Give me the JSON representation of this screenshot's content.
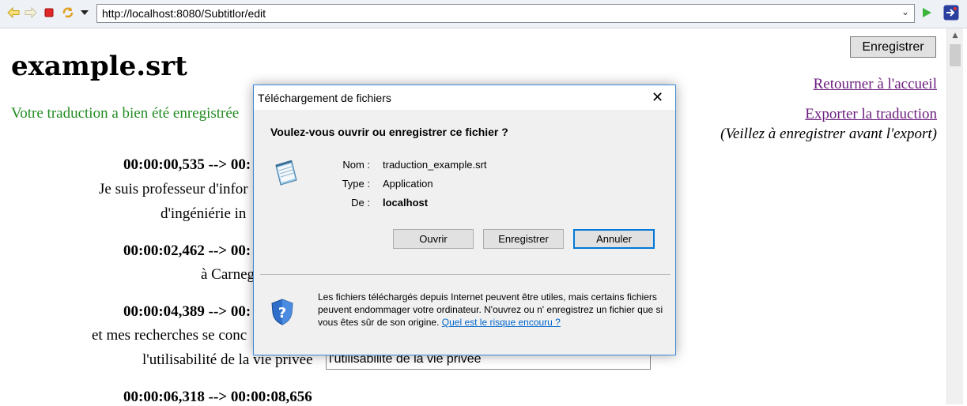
{
  "browser": {
    "url": "http://localhost:8080/Subtitlor/edit",
    "toolbar_icons": [
      "back-arrow-icon",
      "forward-arrow-icon",
      "stop-icon",
      "refresh-icon",
      "dropdown-icon",
      "go-icon",
      "browser-app-icon"
    ]
  },
  "page": {
    "title": "example.srt",
    "save_label": "Enregistrer",
    "home_link": "Retourner à l'accueil",
    "export_link": "Exporter la traduction",
    "export_note": "(Veillez à enregistrer avant l'export)",
    "success_message": "Votre traduction a bien été enregistrée"
  },
  "subtitles": [
    {
      "timestamp": "00:00:00,535 --> 00:",
      "line1": "Je suis professeur d'infor",
      "line2": "d'ingéniérie in"
    },
    {
      "timestamp": "00:00:02,462 --> 00:",
      "line1": "à Carneg"
    },
    {
      "timestamp": "00:00:04,389 --> 00:",
      "line1": "et mes recherches se conc",
      "line2": "l'utilisabilité de la vie privée",
      "input_value": "l'utilisabilité de la vie privée"
    },
    {
      "timestamp": "00:00:06,318 --> 00:00:08,656"
    }
  ],
  "dialog": {
    "title": "Téléchargement de fichiers",
    "question": "Voulez-vous ouvrir ou enregistrer ce fichier ?",
    "name_label": "Nom :",
    "name_value": "traduction_example.srt",
    "type_label": "Type :",
    "type_value": "Application",
    "from_label": "De :",
    "from_value": "localhost",
    "buttons": {
      "open": "Ouvrir",
      "save": "Enregistrer",
      "cancel": "Annuler"
    },
    "warning_text": "Les fichiers téléchargés depuis Internet peuvent être utiles, mais certains fichiers peuvent endommager votre ordinateur. N'ouvrez ou n' enregistrez un fichier que si vous êtes sûr de son origine.",
    "warning_link": "Quel est le risque encouru ?"
  },
  "colors": {
    "link": "#6b1d7d",
    "success": "#228b22",
    "dialog_border": "#3c8ad8",
    "default_button_border": "#0078d7",
    "warning_link": "#0066cc"
  }
}
